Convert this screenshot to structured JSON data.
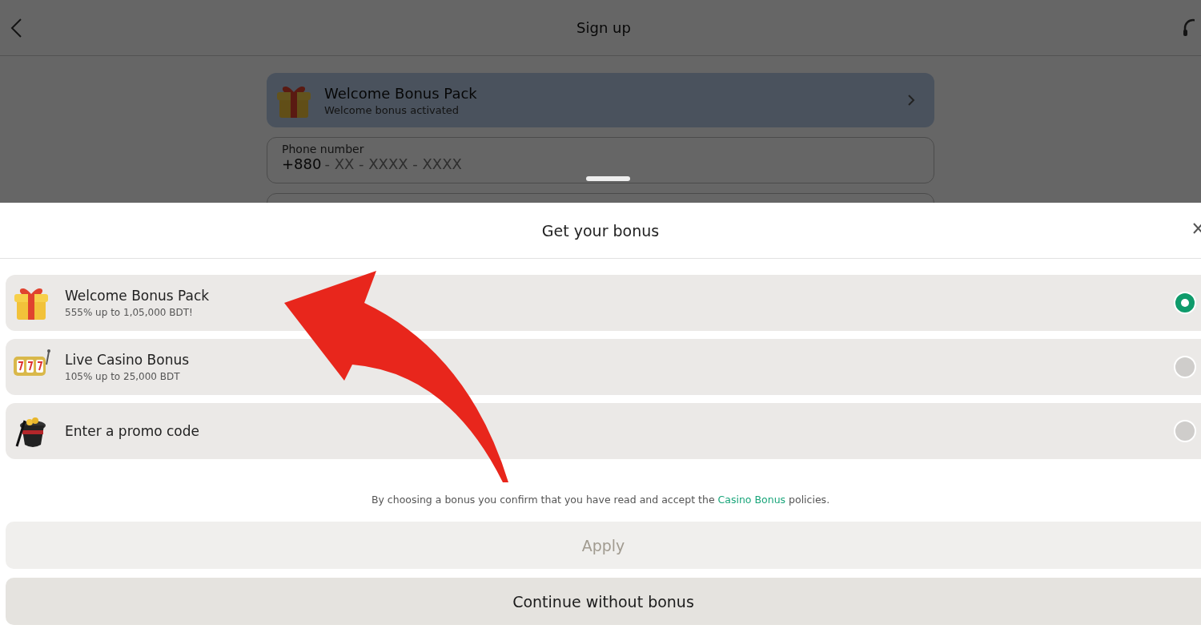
{
  "header": {
    "title": "Sign up"
  },
  "bonus_card": {
    "title": "Welcome Bonus Pack",
    "subtitle": "Welcome bonus activated"
  },
  "phone_field": {
    "label": "Phone number",
    "prefix": "+880",
    "placeholder": "- XX - XXXX - XXXX"
  },
  "sheet": {
    "title": "Get your bonus",
    "bonuses": [
      {
        "title": "Welcome Bonus Pack",
        "subtitle": "555% up to 1,05,000 BDT!",
        "selected": true
      },
      {
        "title": "Live Casino Bonus",
        "subtitle": "105% up to 25,000 BDT",
        "selected": false
      },
      {
        "title": "Enter a promo code",
        "selected": false
      }
    ],
    "disclaimer": {
      "before": "By choosing a bonus you confirm that you have read and accept the",
      "link": "Casino Bonus",
      "after": "policies."
    },
    "buttons": [
      {
        "label": "Apply",
        "disabled": true
      },
      {
        "label": "Continue without bonus",
        "disabled": false
      }
    ]
  }
}
